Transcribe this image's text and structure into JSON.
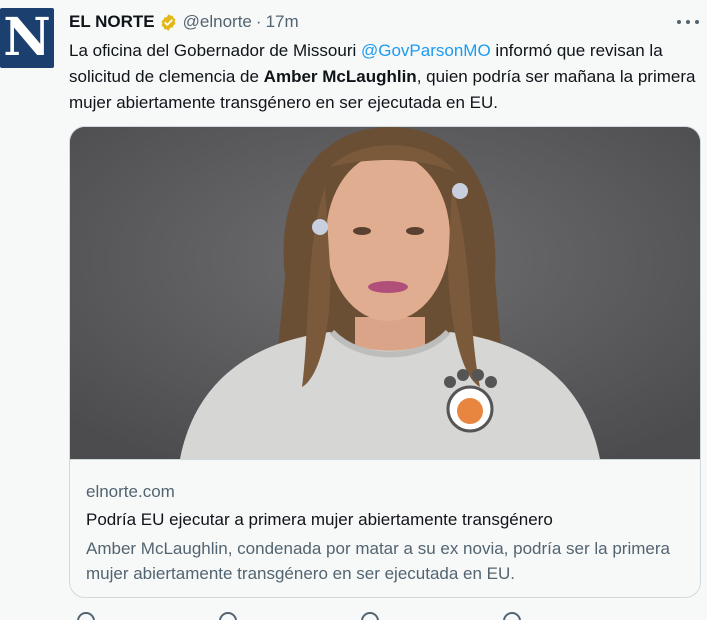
{
  "tweet": {
    "author_name": "EL NORTE",
    "handle": "@elnorte",
    "separator": "·",
    "time": "17m",
    "avatar_letter": "N",
    "text_before_mention": "La oficina del Gobernador de Missouri ",
    "mention": "@GovParsonMO",
    "text_after_mention": " informó que revisan la solicitud de clemencia de ",
    "bold_name": "Amber McLaughlin",
    "text_end": ", quien podría ser mañana la primera mujer abiertamente transgénero en ser ejecutada en EU."
  },
  "card": {
    "domain": "elnorte.com",
    "title": "Podría EU ejecutar a primera mujer abiertamente transgénero",
    "description": "Amber McLaughlin, condenada por matar a su ex novia, podría ser la primera mujer abiertamente transgénero en ser ejecutada en EU."
  },
  "colors": {
    "accent": "#1d9bf0",
    "verified": "#e2b719",
    "secondary_text": "#536471",
    "background": "#f7f9f9"
  },
  "icons": [
    "verified-badge-icon",
    "more-options-icon",
    "reply-icon",
    "retweet-icon",
    "like-icon",
    "share-icon"
  ]
}
